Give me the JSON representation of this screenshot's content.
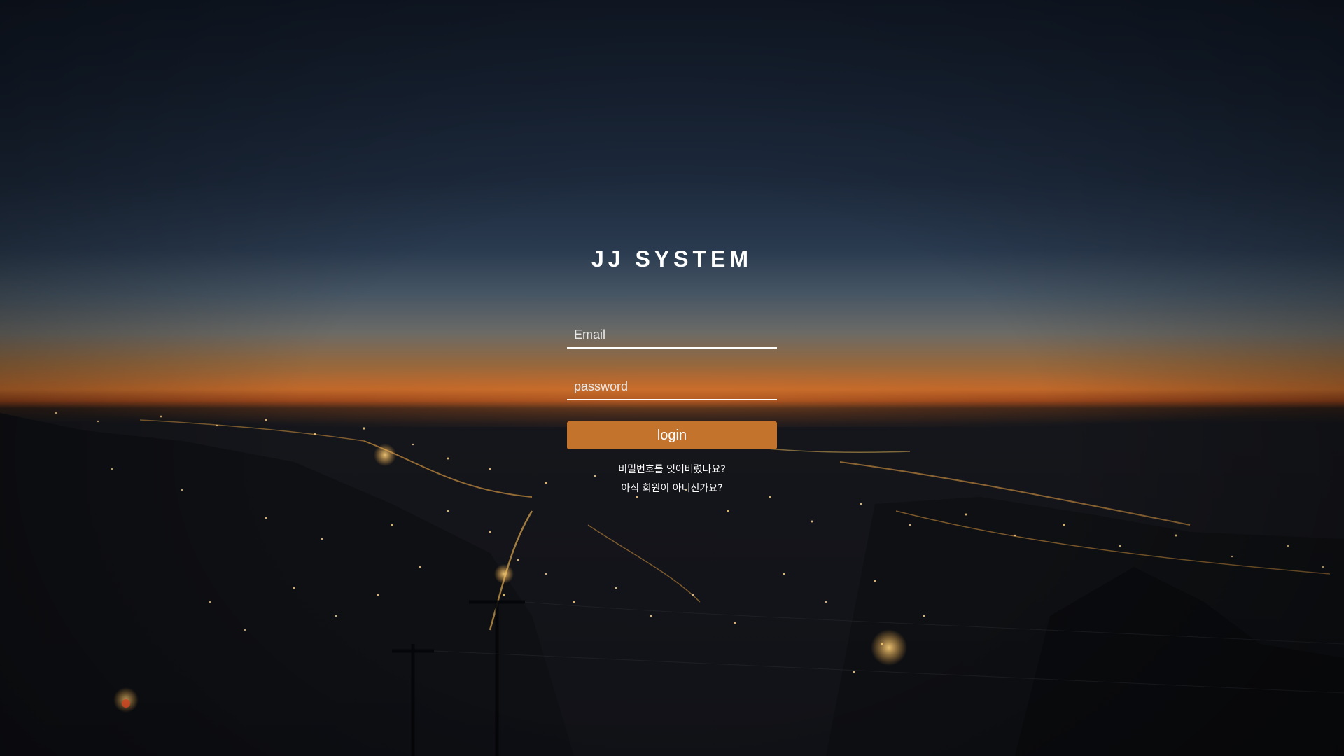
{
  "app": {
    "title": "JJ SYSTEM"
  },
  "form": {
    "email_placeholder": "Email",
    "password_placeholder": "password",
    "login_label": "login",
    "forgot_password_link": "비밀번호를 잊어버렸나요?",
    "signup_link": "아직 회원이 아니신가요?"
  },
  "colors": {
    "accent": "#c4732d",
    "text": "#ffffff"
  }
}
